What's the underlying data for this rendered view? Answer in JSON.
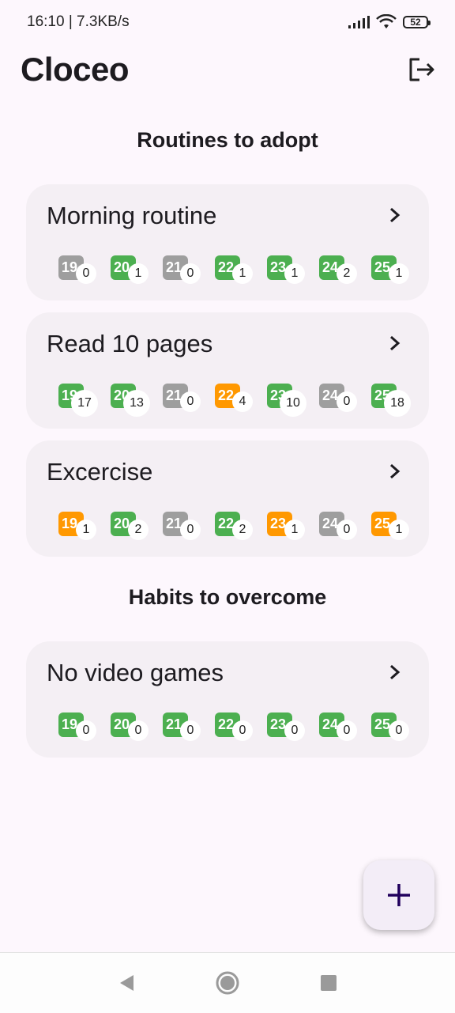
{
  "status_bar": {
    "time_speed": "16:10 | 7.3KB/s",
    "battery": "52",
    "signal_icon": "signal-icon",
    "wifi_icon": "wifi-icon"
  },
  "app_bar": {
    "title": "Cloceo",
    "logout_icon": "logout-icon"
  },
  "sections": {
    "routines_title": "Routines to adopt",
    "habits_title": "Habits to overcome"
  },
  "colors": {
    "green": "#4CAF50",
    "grey": "#9E9E9E",
    "orange": "#FF9800",
    "fab_plus": "#21005D"
  },
  "cards": [
    {
      "title": "Morning routine",
      "days": [
        {
          "day": "19",
          "count": "0",
          "status": "grey"
        },
        {
          "day": "20",
          "count": "1",
          "status": "green"
        },
        {
          "day": "21",
          "count": "0",
          "status": "grey"
        },
        {
          "day": "22",
          "count": "1",
          "status": "green"
        },
        {
          "day": "23",
          "count": "1",
          "status": "green"
        },
        {
          "day": "24",
          "count": "2",
          "status": "green"
        },
        {
          "day": "25",
          "count": "1",
          "status": "green"
        }
      ]
    },
    {
      "title": "Read 10 pages",
      "days": [
        {
          "day": "19",
          "count": "17",
          "status": "green"
        },
        {
          "day": "20",
          "count": "13",
          "status": "green"
        },
        {
          "day": "21",
          "count": "0",
          "status": "grey"
        },
        {
          "day": "22",
          "count": "4",
          "status": "orange"
        },
        {
          "day": "23",
          "count": "10",
          "status": "green"
        },
        {
          "day": "24",
          "count": "0",
          "status": "grey"
        },
        {
          "day": "25",
          "count": "18",
          "status": "green"
        }
      ]
    },
    {
      "title": "Excercise",
      "days": [
        {
          "day": "19",
          "count": "1",
          "status": "orange"
        },
        {
          "day": "20",
          "count": "2",
          "status": "green"
        },
        {
          "day": "21",
          "count": "0",
          "status": "grey"
        },
        {
          "day": "22",
          "count": "2",
          "status": "green"
        },
        {
          "day": "23",
          "count": "1",
          "status": "orange"
        },
        {
          "day": "24",
          "count": "0",
          "status": "grey"
        },
        {
          "day": "25",
          "count": "1",
          "status": "orange"
        }
      ]
    },
    {
      "title": "No video games",
      "days": [
        {
          "day": "19",
          "count": "0",
          "status": "green"
        },
        {
          "day": "20",
          "count": "0",
          "status": "green"
        },
        {
          "day": "21",
          "count": "0",
          "status": "green"
        },
        {
          "day": "22",
          "count": "0",
          "status": "green"
        },
        {
          "day": "23",
          "count": "0",
          "status": "green"
        },
        {
          "day": "24",
          "count": "0",
          "status": "green"
        },
        {
          "day": "25",
          "count": "0",
          "status": "green"
        }
      ]
    }
  ],
  "fab": {
    "icon": "plus-icon"
  },
  "nav": {
    "back_icon": "back-icon",
    "home_icon": "home-icon",
    "recents_icon": "recents-icon"
  }
}
